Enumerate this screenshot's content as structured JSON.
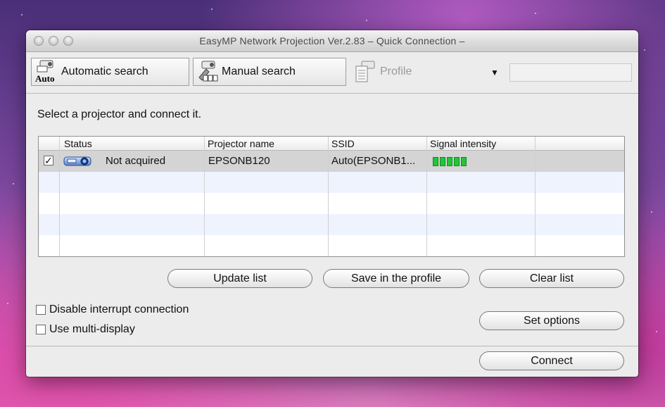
{
  "window": {
    "title": "EasyMP Network Projection Ver.2.83  – Quick Connection –"
  },
  "toolbar": {
    "automatic_search": "Automatic search",
    "automatic_search_icon_text": "Auto",
    "manual_search": "Manual search",
    "profile": "Profile"
  },
  "instruction": "Select a projector and connect it.",
  "table": {
    "columns": [
      "Status",
      "Projector name",
      "SSID",
      "Signal intensity"
    ],
    "rows": [
      {
        "checked": true,
        "status": "Not acquired",
        "projector_name": "EPSONB120",
        "ssid": "Auto(EPSONB1...",
        "signal_bars": 5
      }
    ]
  },
  "buttons": {
    "update_list": "Update list",
    "save_in_profile": "Save in the profile",
    "clear_list": "Clear list",
    "set_options": "Set options",
    "connect": "Connect"
  },
  "options": {
    "disable_interrupt": "Disable interrupt connection",
    "multi_display": "Use multi-display"
  },
  "colors": {
    "signal_bar": "#22c53a",
    "selected_row": "#d4d4d4",
    "alt_row": "#eef3fd"
  }
}
